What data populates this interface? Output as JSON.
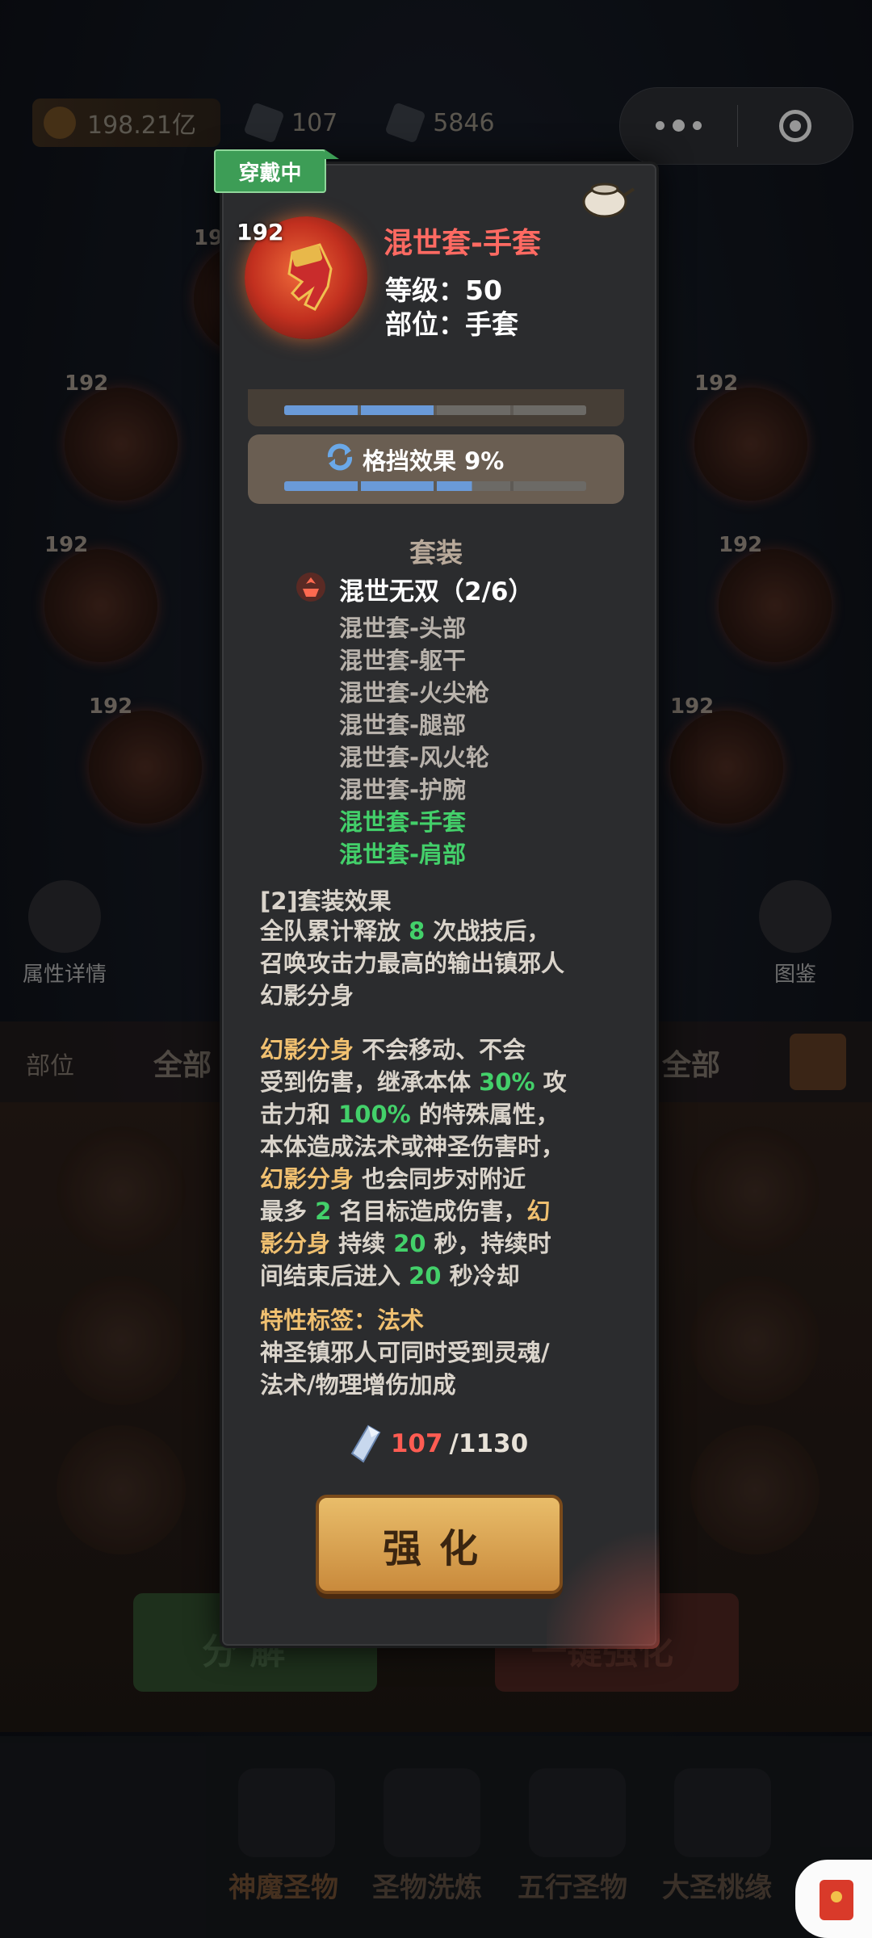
{
  "top_bar": {
    "resources": [
      {
        "icon": "flame-icon",
        "value": "198.21亿"
      },
      {
        "icon": "crystal-icon",
        "value": "107"
      },
      {
        "icon": "ore-icon",
        "value": "5846"
      }
    ]
  },
  "background": {
    "slot_levels": [
      "192",
      "192",
      "192",
      "192",
      "192",
      "192",
      "192"
    ],
    "left_button": "属性详情",
    "right_button": "图鉴",
    "filter_label": "部位",
    "filter_value_left": "全部",
    "filter_value_right": "全部",
    "bottom_left_button": "分 解",
    "bottom_right_button": "一键强化",
    "tabs": [
      "神魔圣物",
      "圣物洗炼",
      "五行圣物",
      "大圣桃缘"
    ]
  },
  "panel": {
    "badge": "穿戴中",
    "item": {
      "level": "192",
      "name": "混世套-手套",
      "level_line": "等级：50",
      "slot_line": "部位：手套"
    },
    "stat": {
      "label": "格挡效果 9%",
      "fill_fraction": 0.62
    },
    "set_section_title": "套装",
    "set_name": "混世无双（2/6）",
    "set_pieces": [
      {
        "text": "混世套-头部",
        "active": false
      },
      {
        "text": "混世套-躯干",
        "active": false
      },
      {
        "text": "混世套-火尖枪",
        "active": false
      },
      {
        "text": "混世套-腿部",
        "active": false
      },
      {
        "text": "混世套-风火轮",
        "active": false
      },
      {
        "text": "混世套-护腕",
        "active": false
      },
      {
        "text": "混世套-手套",
        "active": true
      },
      {
        "text": "混世套-肩部",
        "active": true
      }
    ],
    "effect_title": "[2]套装效果",
    "effect_p1": [
      {
        "t": "全队累计释放 ",
        "c": ""
      },
      {
        "t": "8",
        "c": "g"
      },
      {
        "t": " 次战技后，",
        "c": ""
      },
      {
        "t": "召唤攻击力最高的输出镇邪人",
        "c": "br"
      },
      {
        "t": "幻影分身",
        "c": "br"
      }
    ],
    "effect_p2_lines": [
      [
        {
          "t": "幻影分身",
          "c": "o"
        },
        {
          "t": " 不会移动、不会",
          "c": ""
        }
      ],
      [
        {
          "t": "受到伤害，继承本体 ",
          "c": ""
        },
        {
          "t": "30%",
          "c": "g"
        },
        {
          "t": " 攻",
          "c": ""
        }
      ],
      [
        {
          "t": "击力和 ",
          "c": ""
        },
        {
          "t": "100%",
          "c": "g"
        },
        {
          "t": " 的特殊属性，",
          "c": ""
        }
      ],
      [
        {
          "t": "本体造成法术或神圣伤害时，",
          "c": ""
        }
      ],
      [
        {
          "t": "幻影分身",
          "c": "o"
        },
        {
          "t": " 也会同步对附近",
          "c": ""
        }
      ],
      [
        {
          "t": "最多 ",
          "c": ""
        },
        {
          "t": "2",
          "c": "g"
        },
        {
          "t": " 名目标造成伤害，",
          "c": ""
        },
        {
          "t": "幻",
          "c": "o"
        }
      ],
      [
        {
          "t": "影分身",
          "c": "o"
        },
        {
          "t": " 持续 ",
          "c": ""
        },
        {
          "t": "20",
          "c": "g"
        },
        {
          "t": " 秒，持续时",
          "c": ""
        }
      ],
      [
        {
          "t": "间结束后进入 ",
          "c": ""
        },
        {
          "t": "20",
          "c": "g"
        },
        {
          "t": " 秒冷却",
          "c": ""
        }
      ]
    ],
    "trait_lines": [
      [
        {
          "t": "特性标签：法术",
          "c": "o"
        }
      ],
      [
        {
          "t": "神圣镇邪人可同时受到灵魂/",
          "c": ""
        }
      ],
      [
        {
          "t": "法术/物理增伤加成",
          "c": ""
        }
      ]
    ],
    "cost": {
      "have": "107",
      "need": "/1130"
    },
    "enhance_button": "强化"
  }
}
